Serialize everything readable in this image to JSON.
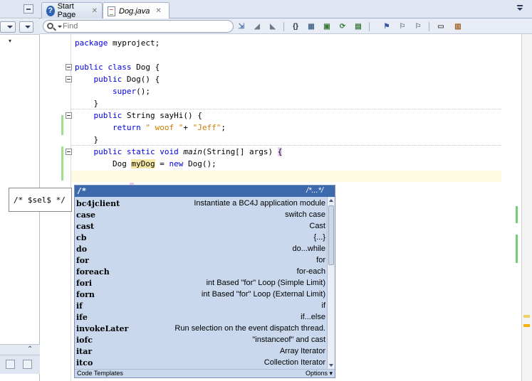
{
  "tabs": [
    {
      "label": "Start Page"
    },
    {
      "label": "Dog.java"
    }
  ],
  "toolbar": {
    "find_placeholder": "Find"
  },
  "code": {
    "line1": [
      "package",
      " myproject;"
    ],
    "line2": [
      "public class",
      " Dog {"
    ],
    "line3": [
      "    public",
      " Dog() {"
    ],
    "line4": [
      "        ",
      "super",
      "();"
    ],
    "line5": "    }",
    "line6": [
      "    public",
      " String sayHi() {"
    ],
    "line7": [
      "        return",
      " ",
      "\" woof \"",
      "+ ",
      "\"Jeff\"",
      ";"
    ],
    "line8": "    }",
    "line9": [
      "    public static void",
      " ",
      "main",
      "(String[] args) ",
      "{"
    ],
    "line10": [
      "        Dog ",
      "myDog",
      " = ",
      "new",
      " Dog();"
    ]
  },
  "completion": {
    "header_left": "/*",
    "header_right": "/*...*/",
    "items": [
      {
        "keyword": "bc4jclient",
        "desc": "Instantiate a BC4J application module"
      },
      {
        "keyword": "case",
        "desc": "switch case"
      },
      {
        "keyword": "cast",
        "desc": "Cast"
      },
      {
        "keyword": "cb",
        "desc": "{...}"
      },
      {
        "keyword": "do",
        "desc": "do...while"
      },
      {
        "keyword": "for",
        "desc": "for"
      },
      {
        "keyword": "foreach",
        "desc": "for-each"
      },
      {
        "keyword": "fori",
        "desc": "int Based \"for\" Loop (Simple Limit)"
      },
      {
        "keyword": "forn",
        "desc": "int Based \"for\" Loop (External Limit)"
      },
      {
        "keyword": "if",
        "desc": "if"
      },
      {
        "keyword": "ife",
        "desc": "if...else"
      },
      {
        "keyword": "invokeLater",
        "desc": "Run selection on the event dispatch thread."
      },
      {
        "keyword": "iofc",
        "desc": "\"instanceof\"  and cast"
      },
      {
        "keyword": "itar",
        "desc": "Array Iterator"
      },
      {
        "keyword": "itco",
        "desc": "Collection Iterator"
      }
    ],
    "footer_left": "Code Templates",
    "footer_right": "Options ▾"
  },
  "tooltip": {
    "text": "/* $sel$ */"
  },
  "icons": [
    "help-icon",
    "java-file-icon",
    "close-icon",
    "search-icon",
    "format-icon",
    "bookmark-icon",
    "breakpoint-icon"
  ],
  "colors": {
    "keyword": "#0000e6",
    "string": "#ce7b00",
    "popup_header": "#3d6aad",
    "popup_bg": "#c9d8ec",
    "change_marker": "#9fe08f"
  }
}
